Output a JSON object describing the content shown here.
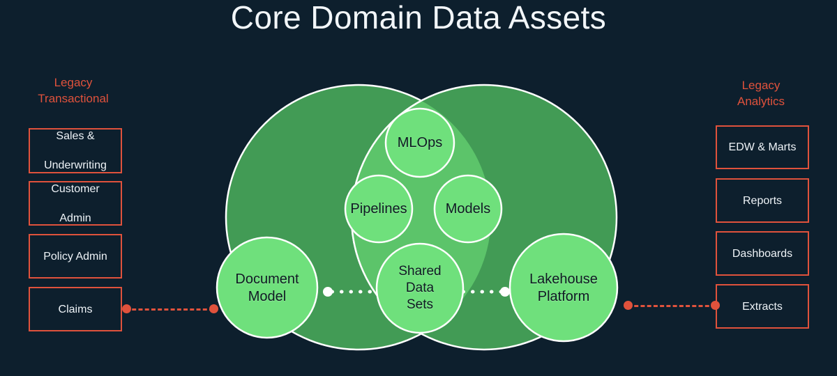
{
  "page": {
    "title": "Core Domain Data Assets",
    "background_color": "#0d1f2d"
  },
  "colors": {
    "accent_red": "#e0523c",
    "venn_outer_green": "#429b55",
    "venn_lens_green": "#5cc46a",
    "bubble_green": "#6fe07c",
    "text_light": "#eef3f7",
    "text_dark": "#0e1a22",
    "connector_white": "#ffffff"
  },
  "left_column": {
    "header": "Legacy\nTransactional",
    "header_line1": "Legacy",
    "header_line2": "Transactional",
    "items": [
      {
        "label_line1": "Sales &",
        "label_line2": "Underwriting"
      },
      {
        "label_line1": "Customer",
        "label_line2": "Admin"
      },
      {
        "label_line1": "Policy Admin",
        "label_line2": ""
      },
      {
        "label_line1": "Claims",
        "label_line2": ""
      }
    ]
  },
  "right_column": {
    "header_line1": "Legacy",
    "header_line2": "Analytics",
    "items": [
      {
        "label_line1": "EDW & Marts",
        "label_line2": ""
      },
      {
        "label_line1": "Reports",
        "label_line2": ""
      },
      {
        "label_line1": "Dashboards",
        "label_line2": ""
      },
      {
        "label_line1": "Extracts",
        "label_line2": ""
      }
    ]
  },
  "venn": {
    "outer_circles": [
      {
        "name": "left-domain-circle"
      },
      {
        "name": "right-domain-circle"
      }
    ],
    "bubbles": [
      {
        "id": "mlops",
        "line1": "MLOps",
        "line2": "",
        "line3": ""
      },
      {
        "id": "pipelines",
        "line1": "Pipelines",
        "line2": "",
        "line3": ""
      },
      {
        "id": "models",
        "line1": "Models",
        "line2": "",
        "line3": ""
      },
      {
        "id": "shared",
        "line1": "Shared",
        "line2": "Data",
        "line3": "Sets"
      },
      {
        "id": "document",
        "line1": "Document",
        "line2": "Model",
        "line3": ""
      },
      {
        "id": "lakehouse",
        "line1": "Lakehouse",
        "line2": "Platform",
        "line3": ""
      }
    ]
  },
  "connectors": {
    "left_red": {
      "from": "claims-box",
      "to": "document-model-bubble",
      "style": "dashed"
    },
    "right_red": {
      "from": "lakehouse-platform-bubble",
      "to": "extracts-box",
      "style": "dashed"
    },
    "left_white": {
      "from": "document-model-bubble",
      "to": "shared-data-sets-bubble",
      "style": "dotted"
    },
    "right_white": {
      "from": "shared-data-sets-bubble",
      "to": "lakehouse-platform-bubble",
      "style": "dotted"
    }
  }
}
